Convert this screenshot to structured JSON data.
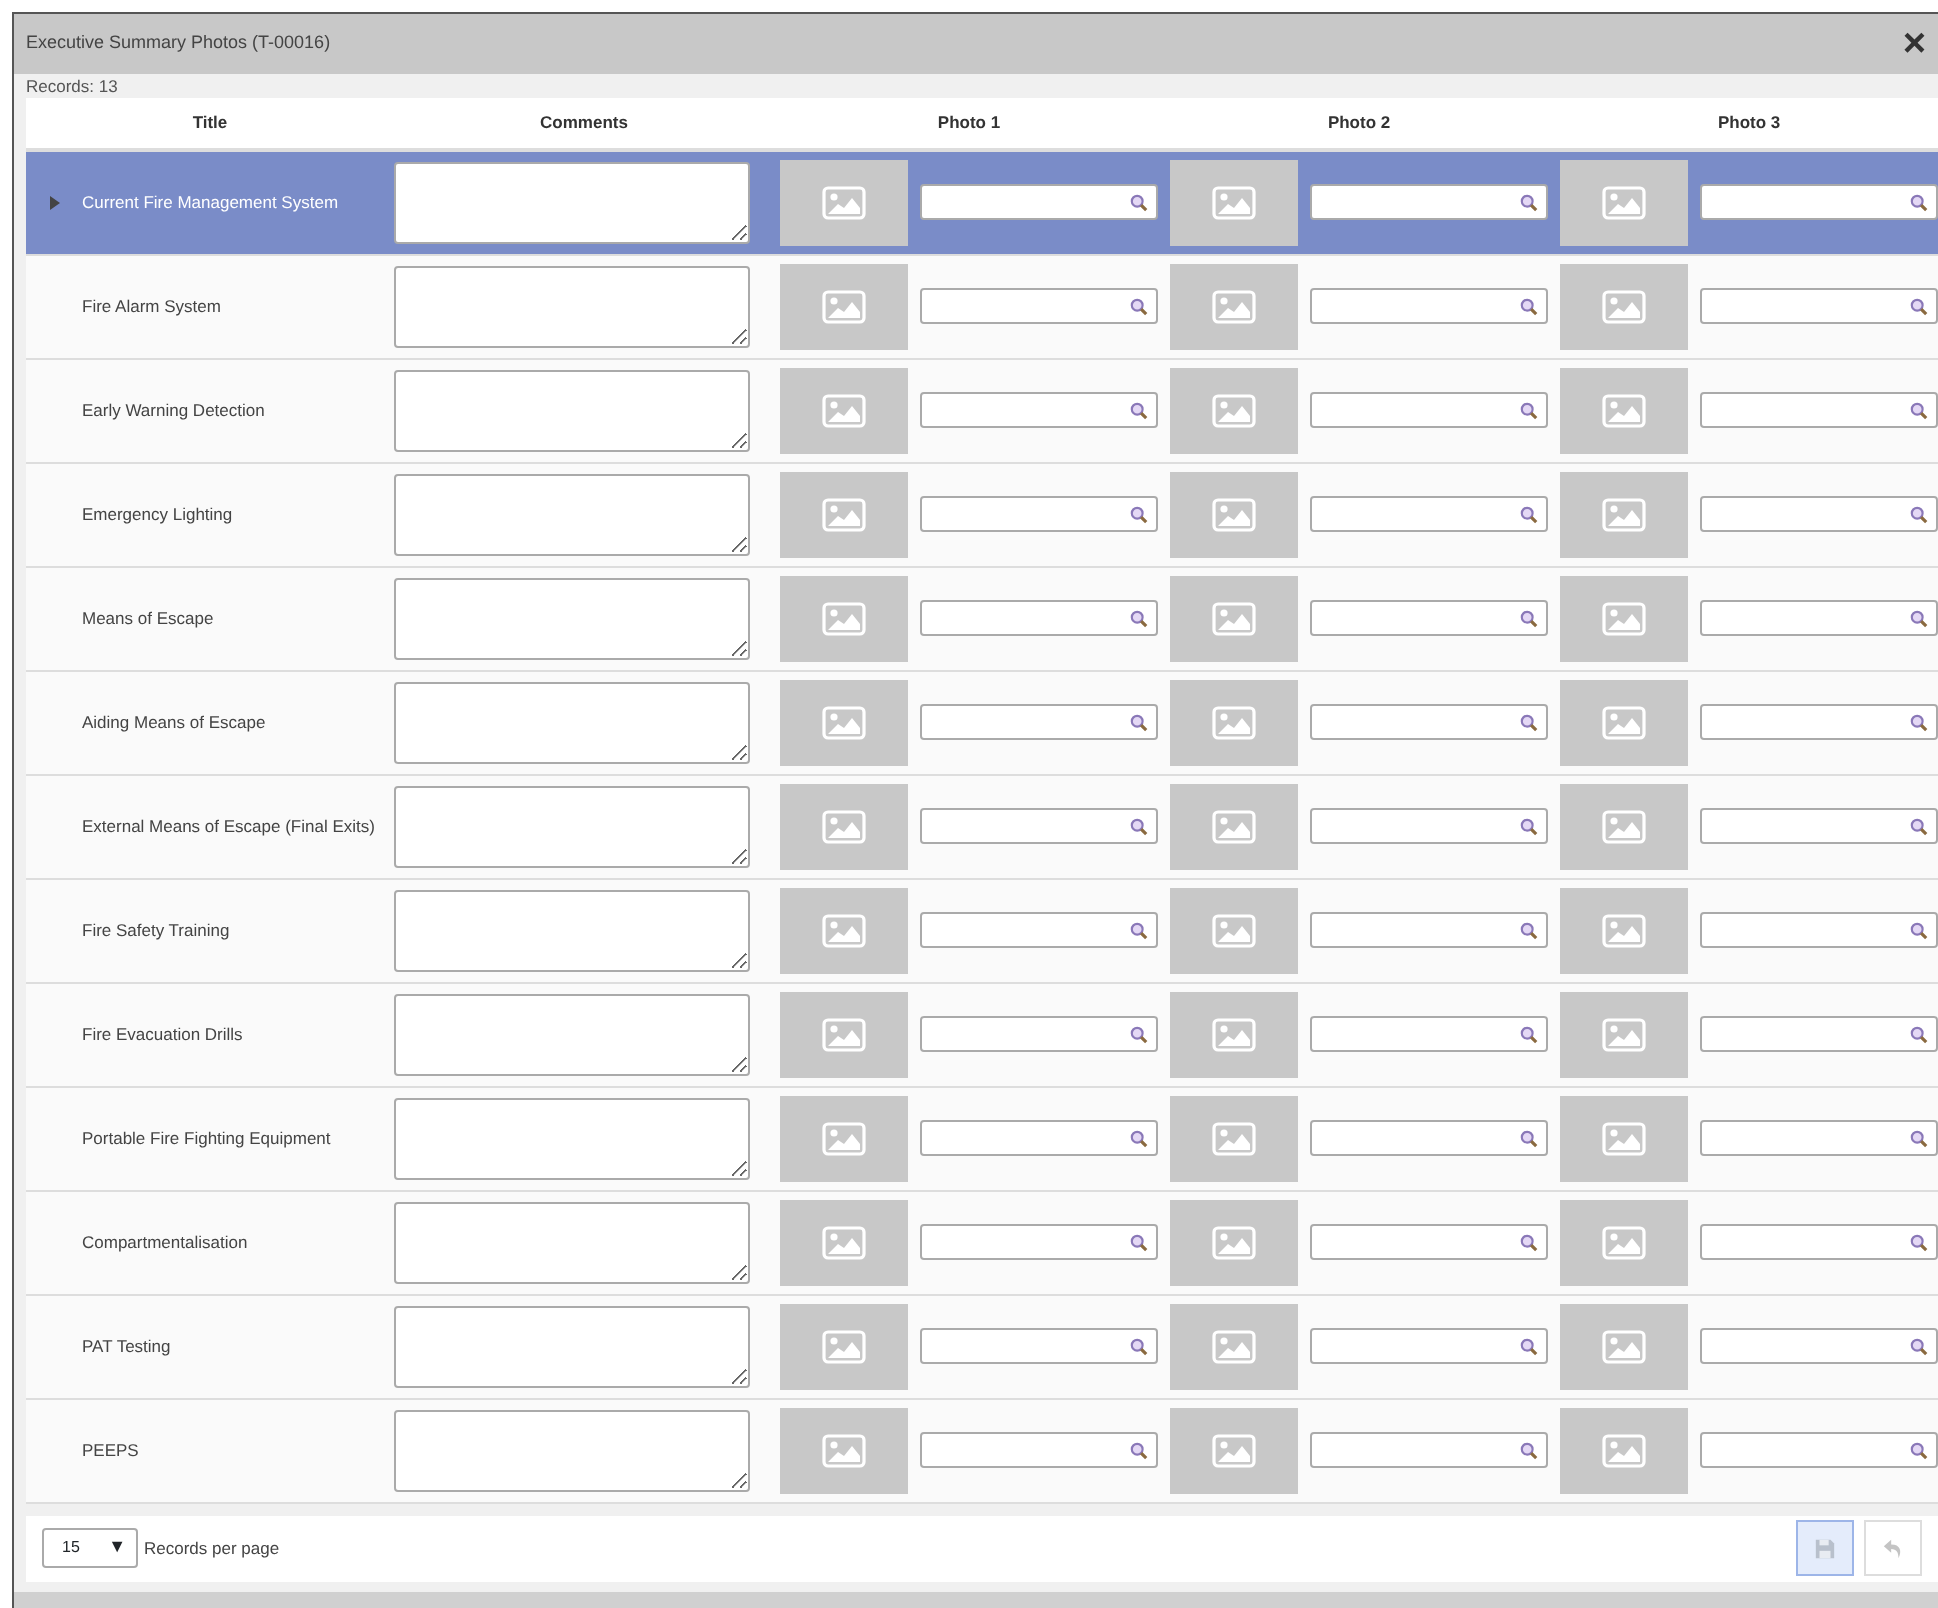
{
  "dialog": {
    "title": "Executive Summary Photos (T-00016)",
    "close": "×"
  },
  "records": {
    "label": "Records:",
    "count": "13"
  },
  "columns": [
    "Title",
    "Comments",
    "Photo 1",
    "Photo 2",
    "Photo 3"
  ],
  "rows": [
    {
      "title": "Current Fire Management System",
      "selected": true
    },
    {
      "title": "Fire Alarm System",
      "selected": false
    },
    {
      "title": "Early Warning Detection",
      "selected": false
    },
    {
      "title": "Emergency Lighting",
      "selected": false
    },
    {
      "title": "Means of Escape",
      "selected": false
    },
    {
      "title": "Aiding Means of Escape",
      "selected": false
    },
    {
      "title": "External Means of Escape (Final Exits)",
      "selected": false
    },
    {
      "title": "Fire Safety Training",
      "selected": false
    },
    {
      "title": "Fire Evacuation Drills",
      "selected": false
    },
    {
      "title": "Portable Fire Fighting Equipment",
      "selected": false
    },
    {
      "title": "Compartmentalisation",
      "selected": false
    },
    {
      "title": "PAT Testing",
      "selected": false
    },
    {
      "title": "PEEPS",
      "selected": false
    }
  ],
  "pager": {
    "page_size": "15",
    "caret": "▼",
    "label": "Records per page"
  },
  "actions": [
    {
      "kind": "save",
      "disabled": false
    },
    {
      "kind": "undo",
      "disabled": true
    }
  ]
}
